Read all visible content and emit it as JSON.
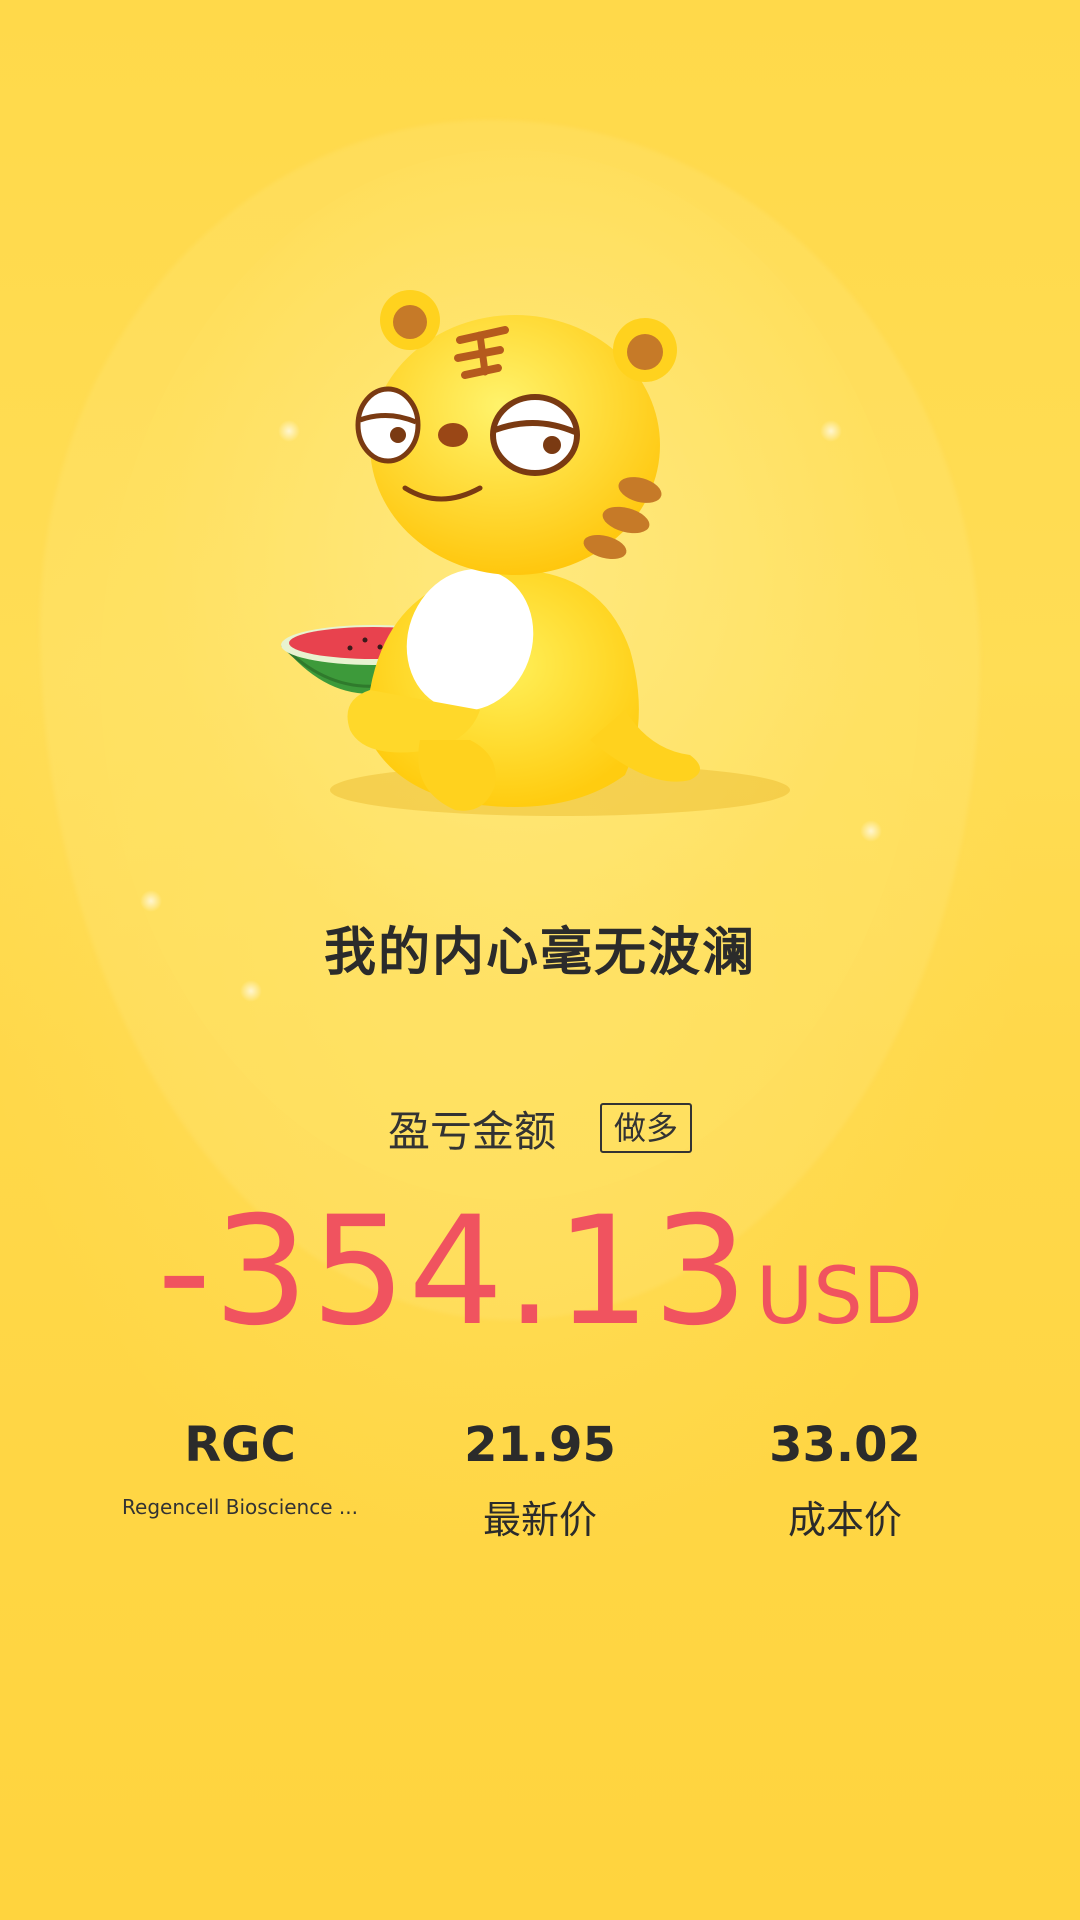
{
  "headline": "我的内心毫无波澜",
  "pnl": {
    "label": "盈亏金额",
    "badge": "做多",
    "value": "-354.13",
    "unit": "USD"
  },
  "stock": {
    "ticker": "RGC",
    "name": "Regencell Bioscience ...",
    "latest_price": "21.95",
    "latest_price_label": "最新价",
    "cost_price": "33.02",
    "cost_price_label": "成本价"
  },
  "colors": {
    "background": "#ffd63f",
    "loss": "#f0535f",
    "text": "#2b2b2b"
  }
}
